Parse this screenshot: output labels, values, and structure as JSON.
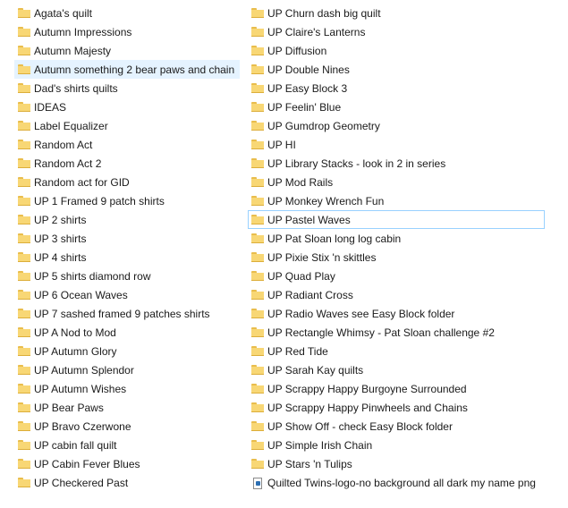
{
  "left_items": [
    {
      "label": "Agata's quilt",
      "icon": "folder-icon"
    },
    {
      "label": "Autumn Impressions",
      "icon": "folder-icon"
    },
    {
      "label": "Autumn Majesty",
      "icon": "folder-icon"
    },
    {
      "label": "Autumn something 2 bear paws and chain",
      "icon": "folder-icon",
      "state": "hover"
    },
    {
      "label": "Dad's shirts quilts",
      "icon": "folder-icon"
    },
    {
      "label": "IDEAS",
      "icon": "folder-icon"
    },
    {
      "label": "Label Equalizer",
      "icon": "folder-icon"
    },
    {
      "label": "Random Act",
      "icon": "folder-icon"
    },
    {
      "label": "Random Act 2",
      "icon": "folder-icon"
    },
    {
      "label": "Random act for GID",
      "icon": "folder-icon"
    },
    {
      "label": "UP 1 Framed 9 patch shirts",
      "icon": "folder-icon"
    },
    {
      "label": "UP 2 shirts",
      "icon": "folder-icon"
    },
    {
      "label": "UP 3 shirts",
      "icon": "folder-icon"
    },
    {
      "label": "UP 4 shirts",
      "icon": "folder-icon"
    },
    {
      "label": "UP 5 shirts diamond row",
      "icon": "folder-icon"
    },
    {
      "label": "UP 6 Ocean Waves",
      "icon": "folder-icon"
    },
    {
      "label": "UP 7 sashed framed 9 patches shirts",
      "icon": "folder-icon"
    },
    {
      "label": "UP A Nod to Mod",
      "icon": "folder-icon"
    },
    {
      "label": "UP Autumn Glory",
      "icon": "folder-icon"
    },
    {
      "label": "UP Autumn Splendor",
      "icon": "folder-icon"
    },
    {
      "label": "UP Autumn Wishes",
      "icon": "folder-icon"
    },
    {
      "label": "UP Bear Paws",
      "icon": "folder-icon"
    },
    {
      "label": "UP Bravo Czerwone",
      "icon": "folder-icon"
    },
    {
      "label": "UP cabin fall quilt",
      "icon": "folder-icon"
    },
    {
      "label": "UP Cabin Fever Blues",
      "icon": "folder-icon"
    },
    {
      "label": "UP Checkered Past",
      "icon": "folder-icon"
    }
  ],
  "right_items": [
    {
      "label": "UP Churn dash big quilt",
      "icon": "folder-icon"
    },
    {
      "label": "UP Claire's Lanterns",
      "icon": "folder-icon"
    },
    {
      "label": "UP Diffusion",
      "icon": "folder-icon"
    },
    {
      "label": "UP Double Nines",
      "icon": "folder-icon"
    },
    {
      "label": "UP Easy Block 3",
      "icon": "folder-icon"
    },
    {
      "label": "UP Feelin' Blue",
      "icon": "folder-icon"
    },
    {
      "label": "UP Gumdrop Geometry",
      "icon": "folder-icon"
    },
    {
      "label": "UP HI",
      "icon": "folder-icon"
    },
    {
      "label": "UP Library Stacks - look in 2 in series",
      "icon": "folder-icon"
    },
    {
      "label": "UP Mod Rails",
      "icon": "folder-icon"
    },
    {
      "label": "UP Monkey Wrench Fun",
      "icon": "folder-icon"
    },
    {
      "label": "UP Pastel Waves",
      "icon": "folder-icon",
      "state": "focused"
    },
    {
      "label": "UP Pat Sloan long log cabin",
      "icon": "folder-icon"
    },
    {
      "label": "UP Pixie Stix 'n skittles",
      "icon": "folder-icon"
    },
    {
      "label": "UP Quad Play",
      "icon": "folder-icon"
    },
    {
      "label": "UP Radiant Cross",
      "icon": "folder-icon"
    },
    {
      "label": "UP Radio Waves see Easy Block folder",
      "icon": "folder-icon"
    },
    {
      "label": "UP Rectangle Whimsy - Pat Sloan challenge #2",
      "icon": "folder-icon"
    },
    {
      "label": "UP Red Tide",
      "icon": "folder-icon"
    },
    {
      "label": "UP Sarah Kay quilts",
      "icon": "folder-icon"
    },
    {
      "label": "UP Scrappy Happy Burgoyne Surrounded",
      "icon": "folder-icon"
    },
    {
      "label": "UP Scrappy Happy Pinwheels and Chains",
      "icon": "folder-icon"
    },
    {
      "label": "UP Show Off - check Easy Block folder",
      "icon": "folder-icon"
    },
    {
      "label": "UP Simple Irish Chain",
      "icon": "folder-icon"
    },
    {
      "label": "UP Stars 'n Tulips",
      "icon": "folder-icon"
    },
    {
      "label": "Quilted Twins-logo-no background all dark my name png",
      "icon": "image-file-icon"
    }
  ],
  "colors": {
    "hover_background": "#e5f3ff",
    "focus_border": "#99d1ff",
    "folder": "#f8d775"
  }
}
